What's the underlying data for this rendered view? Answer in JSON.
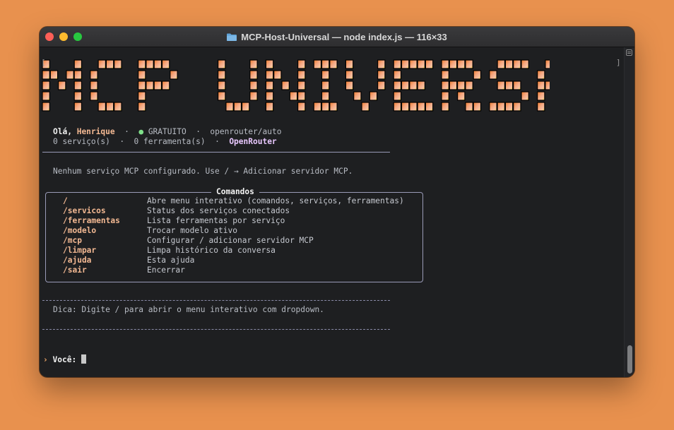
{
  "window": {
    "title": "MCP-Host-Universal — node index.js — 116×33",
    "folder_icon": "folder-icon"
  },
  "banner": {
    "text": "MCP UNIVERSAL",
    "left_bracket": "[",
    "right_bracket": "]",
    "gradient_colors": [
      "#f08a3a",
      "#f5a882",
      "#f6c8a5",
      "#f5d24a"
    ]
  },
  "status": {
    "greeting": "Olá,",
    "user": "Henrique",
    "sep": "·",
    "dot": "●",
    "plan": "GRATUITO",
    "model": "openrouter/auto",
    "services": "0 serviço(s)",
    "tools": "0 ferramenta(s)",
    "provider": "OpenRouter"
  },
  "notice": "Nenhum serviço MCP configurado. Use / → Adicionar servidor MCP.",
  "commands": {
    "title": "Comandos",
    "items": [
      {
        "name": "/",
        "desc": "Abre menu interativo (comandos, serviços, ferramentas)"
      },
      {
        "name": "/servicos",
        "desc": "Status dos serviços conectados"
      },
      {
        "name": "/ferramentas",
        "desc": "Lista ferramentas por serviço"
      },
      {
        "name": "/modelo",
        "desc": "Trocar modelo ativo"
      },
      {
        "name": "/mcp",
        "desc": "Configurar / adicionar servidor MCP"
      },
      {
        "name": "/limpar",
        "desc": "Limpa histórico da conversa"
      },
      {
        "name": "/ajuda",
        "desc": "Esta ajuda"
      },
      {
        "name": "/sair",
        "desc": "Encerrar"
      }
    ]
  },
  "tip": "Dica: Digite / para abrir o menu interativo com dropdown.",
  "prompt": {
    "chevron": "›",
    "label": "Você:"
  },
  "colors": {
    "accent": "#f2b892",
    "status_ok": "#7fe08a",
    "provider": "#e9c8ff"
  }
}
